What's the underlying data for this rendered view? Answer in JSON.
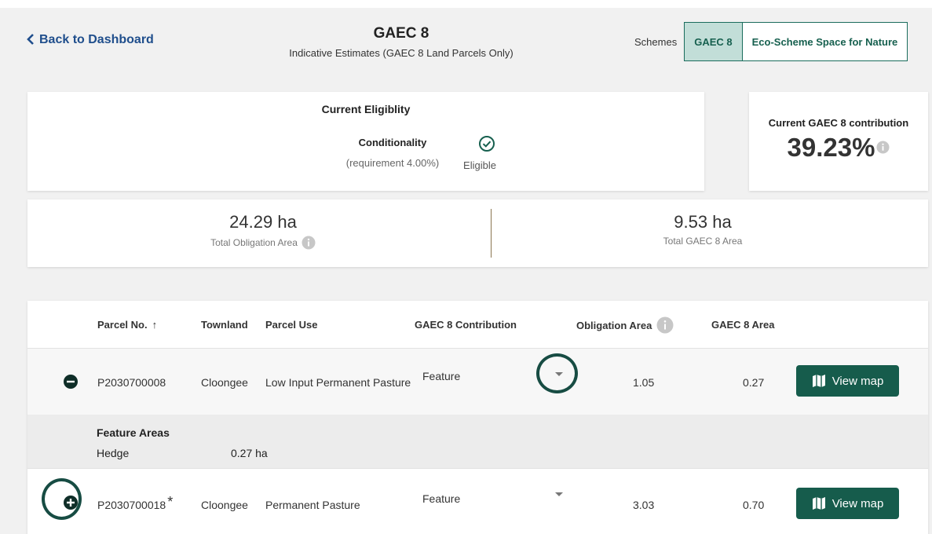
{
  "nav": {
    "back_label": "Back to Dashboard"
  },
  "header": {
    "title": "GAEC 8",
    "subtitle": "Indicative Estimates (GAEC 8 Land Parcels Only)"
  },
  "schemes": {
    "label": "Schemes",
    "options": [
      "GAEC 8",
      "Eco-Scheme Space for Nature"
    ],
    "selected": "GAEC 8"
  },
  "eligibility": {
    "heading": "Current Eligiblity",
    "condition_label": "Conditionality",
    "requirement": "(requirement 4.00%)",
    "status": "Eligible"
  },
  "contribution": {
    "heading": "Current GAEC 8 contribution",
    "value": "39.23%"
  },
  "totals": {
    "obligation_value": "24.29 ha",
    "obligation_label": "Total Obligation Area",
    "gaec_value": "9.53 ha",
    "gaec_label": "Total GAEC 8 Area"
  },
  "table": {
    "columns": [
      "Parcel No.",
      "Townland",
      "Parcel Use",
      "GAEC 8 Contribution",
      "Obligation Area",
      "GAEC 8 Area"
    ],
    "sort_indicator": "↑",
    "rows": [
      {
        "parcel": "P2030700008",
        "asterisk": "",
        "townland": "Cloongee",
        "use": "Low Input Permanent Pasture",
        "contribution": "Feature",
        "obligation": "1.05",
        "gaec_area": "0.27",
        "action": "View map",
        "expanded": true
      },
      {
        "parcel": "P2030700018",
        "asterisk": "*",
        "townland": "Cloongee",
        "use": "Permanent Pasture",
        "contribution": "Feature",
        "obligation": "3.03",
        "gaec_area": "0.70",
        "action": "View map",
        "expanded": false
      }
    ],
    "feature_areas": {
      "heading": "Feature Areas",
      "items": [
        {
          "name": "Hedge",
          "area": "0.27 ha"
        }
      ]
    }
  },
  "colors": {
    "accent": "#165c4c",
    "link": "#1f4e8c",
    "segment_active_bg": "#c2ded8",
    "ring": "#174c43"
  }
}
